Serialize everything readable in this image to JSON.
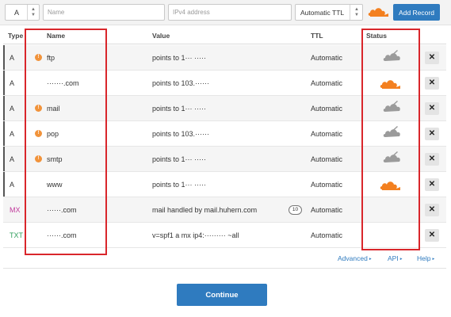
{
  "add_record": {
    "type_value": "A",
    "name_placeholder": "Name",
    "value_placeholder": "IPv4 address",
    "ttl_value": "Automatic TTL",
    "add_button": "Add Record"
  },
  "columns": {
    "type": "Type",
    "name": "Name",
    "value": "Value",
    "ttl": "TTL",
    "status": "Status"
  },
  "records": [
    {
      "type": "A",
      "name": "ftp",
      "value": "points to 1··· ·····",
      "ttl": "Automatic",
      "dot": true,
      "status": "dns-only"
    },
    {
      "type": "A",
      "name": "·······.com",
      "value": "points to 103.······",
      "ttl": "Automatic",
      "dot": false,
      "status": "proxied"
    },
    {
      "type": "A",
      "name": "mail",
      "value": "points to 1··· ·····",
      "ttl": "Automatic",
      "dot": true,
      "status": "dns-only"
    },
    {
      "type": "A",
      "name": "pop",
      "value": "points to 103.······",
      "ttl": "Automatic",
      "dot": true,
      "status": "dns-only"
    },
    {
      "type": "A",
      "name": "smtp",
      "value": "points to 1··· ·····",
      "ttl": "Automatic",
      "dot": true,
      "status": "dns-only"
    },
    {
      "type": "A",
      "name": "www",
      "value": "points to 1··· ·····",
      "ttl": "Automatic",
      "dot": false,
      "status": "proxied"
    },
    {
      "type": "MX",
      "name": "······.com",
      "value": "mail handled by mail.huhern.com",
      "priority": "10",
      "ttl": "Automatic",
      "dot": false,
      "status": ""
    },
    {
      "type": "TXT",
      "name": "······.com",
      "value": "v=spf1 a mx ip4:········· ~all",
      "ttl": "Automatic",
      "dot": false,
      "status": ""
    }
  ],
  "type_colors": {
    "A": "#333333",
    "MX": "#c0399b",
    "TXT": "#2e9e5b"
  },
  "status_colors": {
    "proxied": "#f38020",
    "dns-only": "#9b9b9b"
  },
  "links": {
    "advanced": "Advanced",
    "api": "API",
    "help": "Help"
  },
  "continue_button": "Continue",
  "icons": {
    "dot": "!",
    "delete": "✕",
    "arrow": "▸"
  }
}
